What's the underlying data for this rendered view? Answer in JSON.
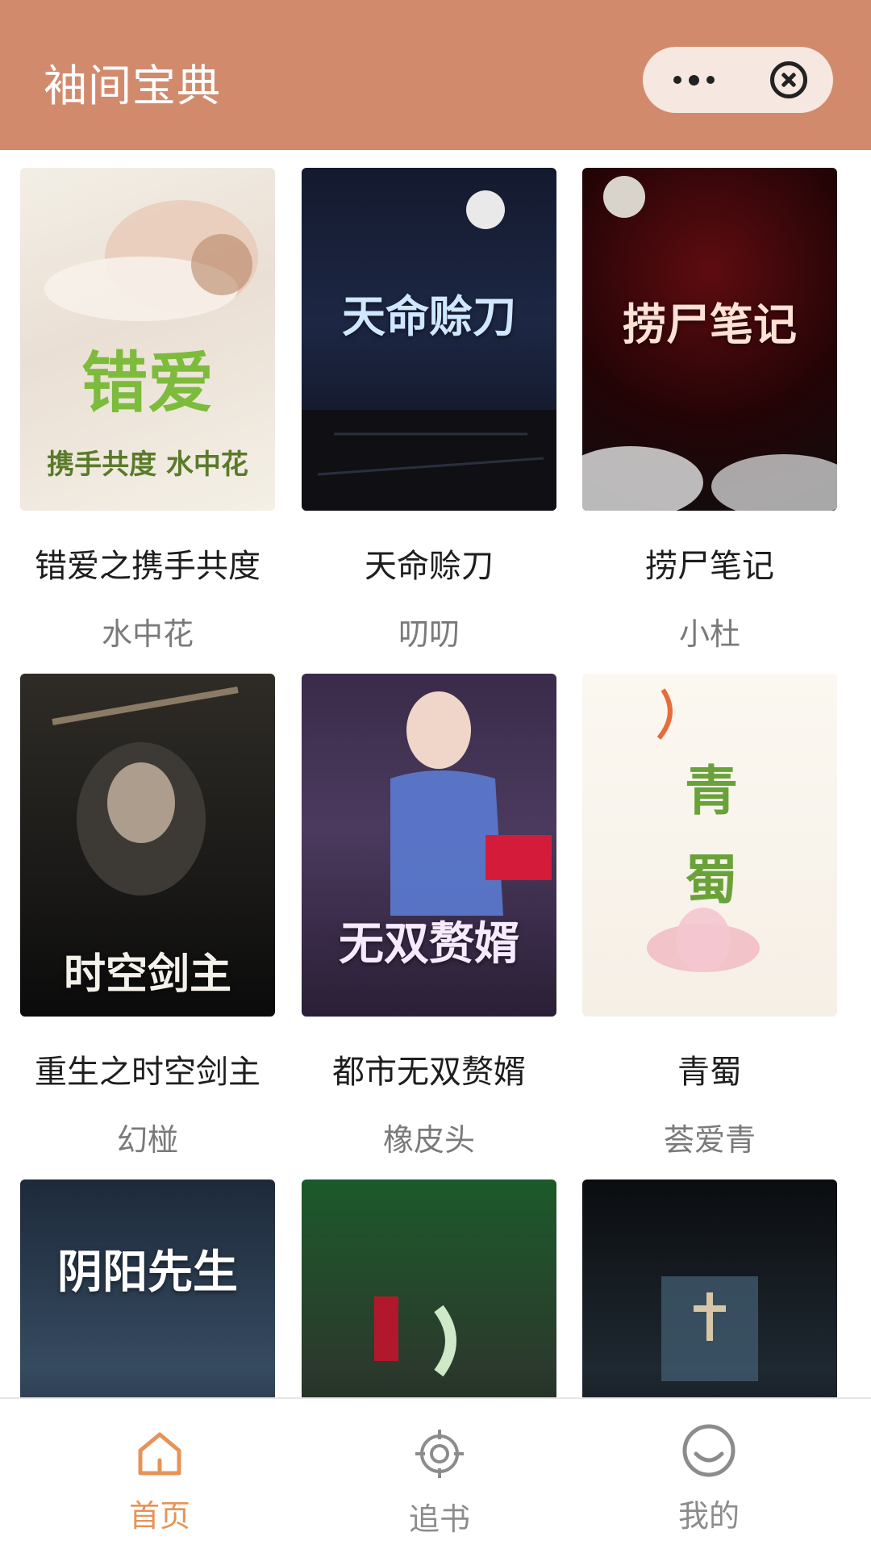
{
  "header": {
    "title": "袖间宝典"
  },
  "books": [
    {
      "title": "错爱之携手共度",
      "author": "水中花",
      "cover_text": "错爱",
      "cover_sub": "携手共度 水中花"
    },
    {
      "title": "天命赊刀",
      "author": "叨叨",
      "cover_text": "天命赊刀"
    },
    {
      "title": "捞尸笔记",
      "author": "小杜",
      "cover_text": "捞尸笔记"
    },
    {
      "title": "重生之时空剑主",
      "author": "幻椪",
      "cover_text": "时空剑主"
    },
    {
      "title": "都市无双赘婿",
      "author": "橡皮头",
      "cover_text": "无双赘婿"
    },
    {
      "title": "青蜀",
      "author": "荟爱青",
      "cover_text": "青蜀"
    },
    {
      "title": "",
      "author": "",
      "cover_text": "阴阳先生"
    },
    {
      "title": "",
      "author": "",
      "cover_text": ""
    },
    {
      "title": "",
      "author": "",
      "cover_text": ""
    }
  ],
  "tabbar": {
    "items": [
      {
        "label": "首页",
        "icon": "home-icon",
        "active": true
      },
      {
        "label": "追书",
        "icon": "target-icon",
        "active": false
      },
      {
        "label": "我的",
        "icon": "smile-icon",
        "active": false
      }
    ]
  },
  "colors": {
    "header": "#d28a6c",
    "active_tab": "#e79357",
    "inactive_tab": "#8c8c8c"
  }
}
